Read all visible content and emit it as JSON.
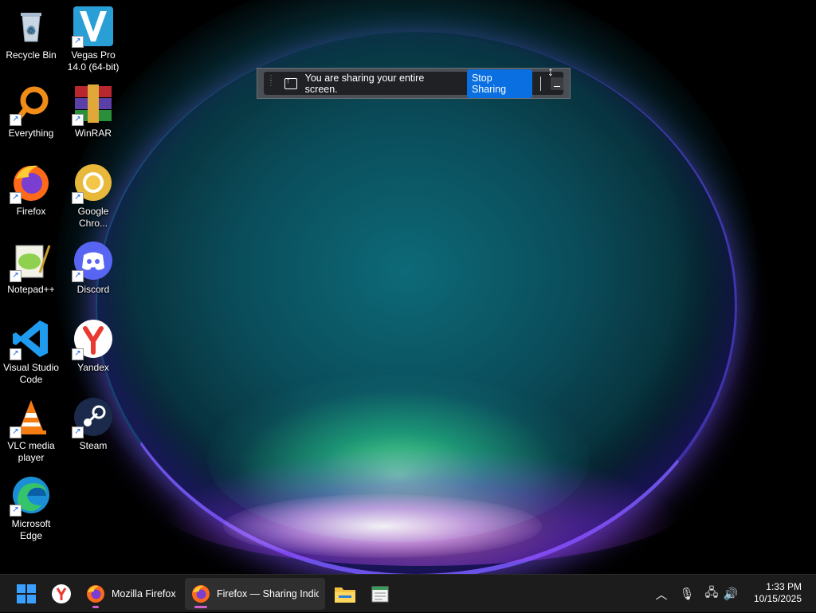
{
  "desktop": {
    "icons": [
      {
        "label": "Recycle Bin"
      },
      {
        "label": "Vegas Pro 14.0 (64-bit)"
      },
      {
        "label": "Everything"
      },
      {
        "label": "WinRAR"
      },
      {
        "label": "Firefox"
      },
      {
        "label": "Google Chro..."
      },
      {
        "label": "Notepad++"
      },
      {
        "label": "Discord"
      },
      {
        "label": "Visual Studio Code"
      },
      {
        "label": "Yandex"
      },
      {
        "label": "VLC media player"
      },
      {
        "label": "Steam"
      },
      {
        "label": "Microsoft Edge"
      }
    ]
  },
  "sharing_indicator": {
    "message": "You are sharing your entire screen.",
    "stop_label": "Stop Sharing"
  },
  "taskbar": {
    "items": [
      {
        "label": "Mozilla Firefox"
      },
      {
        "label": "Firefox — Sharing Indica"
      }
    ],
    "clock": {
      "time": "1:33 PM",
      "date": "10/15/2025"
    }
  },
  "colors": {
    "accent": "#0a6fe0",
    "taskbar": "#1c1c1c",
    "firefox_indicator": "#d25fcf"
  }
}
